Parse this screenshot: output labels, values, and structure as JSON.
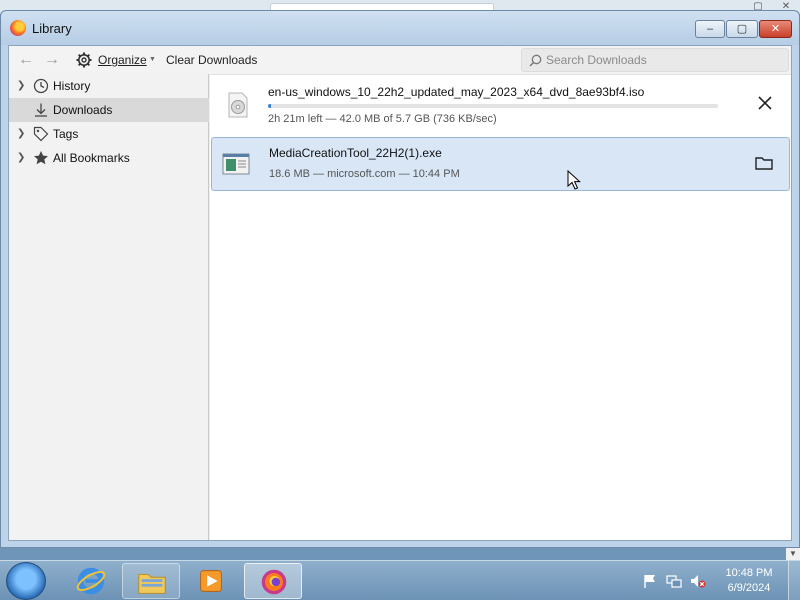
{
  "window": {
    "title": "Library",
    "controls": {
      "minimize": "–",
      "maximize": "▢",
      "close": "✕"
    }
  },
  "toolbar": {
    "back_icon": "back-arrow-icon",
    "forward_icon": "forward-arrow-icon",
    "organize_label": "Organize",
    "clear_label": "Clear Downloads",
    "search_placeholder": "Search Downloads"
  },
  "sidebar": {
    "items": [
      {
        "label": "History",
        "icon": "clock-icon",
        "expandable": true,
        "selected": false
      },
      {
        "label": "Downloads",
        "icon": "download-icon",
        "expandable": false,
        "selected": true
      },
      {
        "label": "Tags",
        "icon": "tag-icon",
        "expandable": true,
        "selected": false
      },
      {
        "label": "All Bookmarks",
        "icon": "star-icon",
        "expandable": true,
        "selected": false
      }
    ]
  },
  "downloads": [
    {
      "name": "en-us_windows_10_22h2_updated_may_2023_x64_dvd_8ae93bf4.iso",
      "status": "2h 21m left — 42.0 MB of 5.7 GB (736 KB/sec)",
      "progress": 0.007,
      "icon": "disc-file-icon",
      "action": "cancel-icon",
      "selected": false
    },
    {
      "name": "MediaCreationTool_22H2(1).exe",
      "status": "18.6 MB — microsoft.com — 10:44 PM",
      "icon": "exe-file-icon",
      "action": "folder-icon",
      "selected": true
    }
  ],
  "taskbar": {
    "apps": [
      "internet-explorer-icon",
      "file-explorer-icon",
      "media-player-icon",
      "firefox-icon"
    ],
    "tray": [
      "flag-icon",
      "network-icon",
      "volume-muted-icon"
    ],
    "time": "10:48 PM",
    "date": "6/9/2024"
  },
  "colors": {
    "selection": "#d8e6f6",
    "progress": "#3c83d4",
    "close_button": "#c8402b"
  }
}
